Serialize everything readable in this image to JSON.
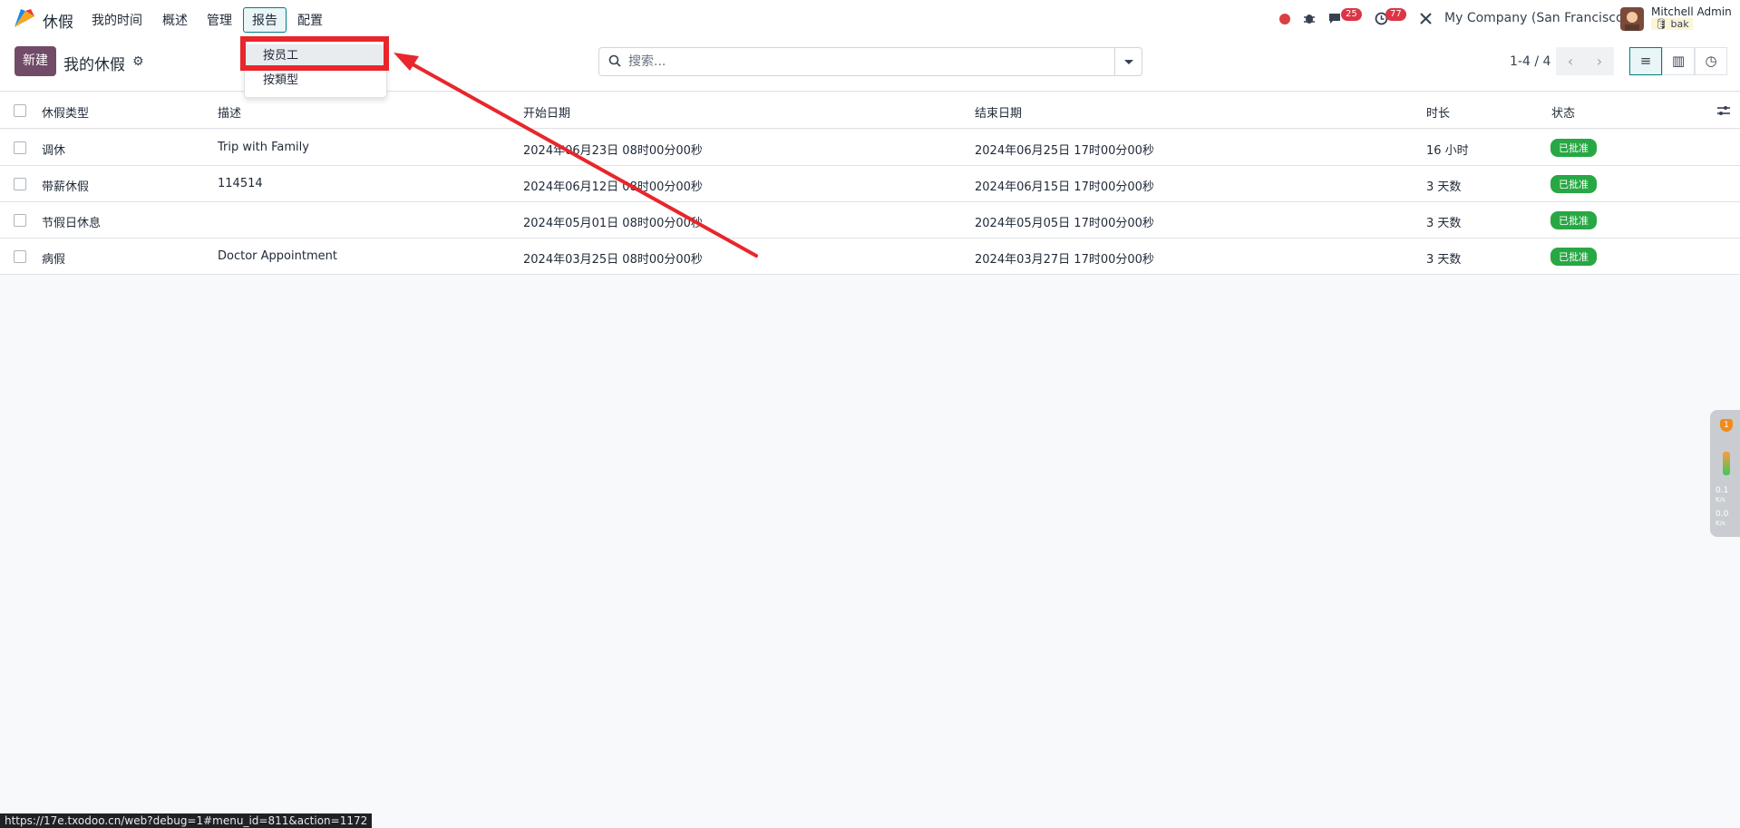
{
  "navbar": {
    "app_name": "休假",
    "menu": [
      "我的时间",
      "概述",
      "管理",
      "报告",
      "配置"
    ],
    "active_menu": "报告",
    "messages_count": "25",
    "activities_count": "77",
    "company": "My Company (San Francisco)",
    "user_name": "Mitchell Admin",
    "user_db": "bak"
  },
  "control": {
    "new_label": "新建",
    "title": "我的休假",
    "search_placeholder": "搜索...",
    "pager": "1-4 / 4"
  },
  "dropdown": {
    "items": [
      "按员工",
      "按類型"
    ]
  },
  "table": {
    "columns": [
      "休假类型",
      "描述",
      "开始日期",
      "结束日期",
      "时长",
      "状态"
    ],
    "rows": [
      {
        "type": "调休",
        "desc": "Trip with Family",
        "start": "2024年06月23日 08时00分00秒",
        "end": "2024年06月25日 17时00分00秒",
        "duration": "16 小时",
        "status": "已批准"
      },
      {
        "type": "带薪休假",
        "desc": "114514",
        "start": "2024年06月12日 08时00分00秒",
        "end": "2024年06月15日 17时00分00秒",
        "duration": "3 天数",
        "status": "已批准"
      },
      {
        "type": "节假日休息",
        "desc": "",
        "start": "2024年05月01日 08时00分00秒",
        "end": "2024年05月05日 17时00分00秒",
        "duration": "3 天数",
        "status": "已批准"
      },
      {
        "type": "病假",
        "desc": "Doctor Appointment",
        "start": "2024年03月25日 08时00分00秒",
        "end": "2024年03月27日 17时00分00秒",
        "duration": "3 天数",
        "status": "已批准"
      }
    ]
  },
  "status_url": "https://17e.txodoo.cn/web?debug=1#menu_id=811&action=1172",
  "side_widget": {
    "badge": "1",
    "up_value": "0.1",
    "up_unit": "K/s",
    "down_value": "0.0",
    "down_unit": "K/s"
  },
  "colors": {
    "brand": "#714b67",
    "accent": "#017e84",
    "approved": "#28a745",
    "highlight": "#e8262b"
  }
}
